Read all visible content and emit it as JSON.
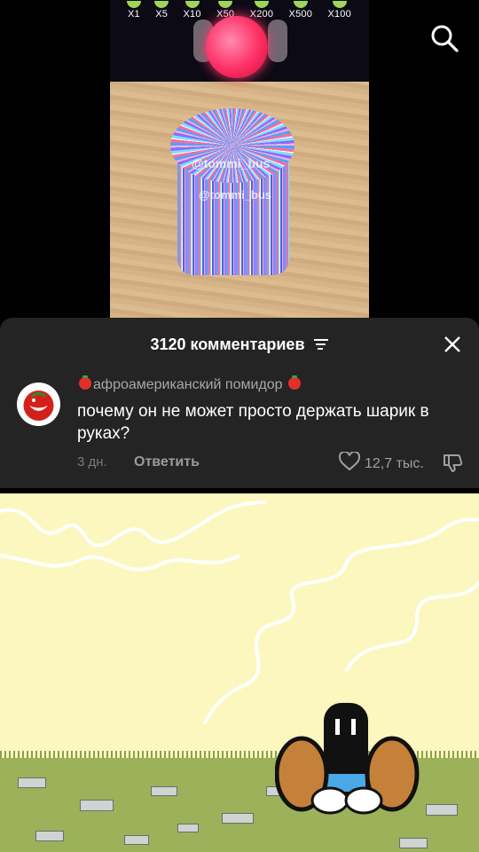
{
  "video": {
    "multipliers": [
      "X1",
      "X5",
      "X10",
      "X50",
      "X200",
      "X500",
      "X100"
    ],
    "watermark_1": "@tommi_bus",
    "watermark_2": "@tommi_bus"
  },
  "header": {
    "search_icon": "search-icon"
  },
  "comments": {
    "title": "3120 комментариев",
    "filter_icon": "filter-icon",
    "close_icon": "close-icon",
    "items": [
      {
        "username": "афроамериканский помидор",
        "text": "почему он не может просто держать шарик в руках?",
        "age": "3 дн.",
        "reply_label": "Ответить",
        "likes": "12,7 тыс."
      }
    ]
  },
  "colors": {
    "sheet_bg": "#242424",
    "scene_bg": "#fbf7bf",
    "ground": "#9bb25a",
    "ball": "#ff2e63"
  }
}
